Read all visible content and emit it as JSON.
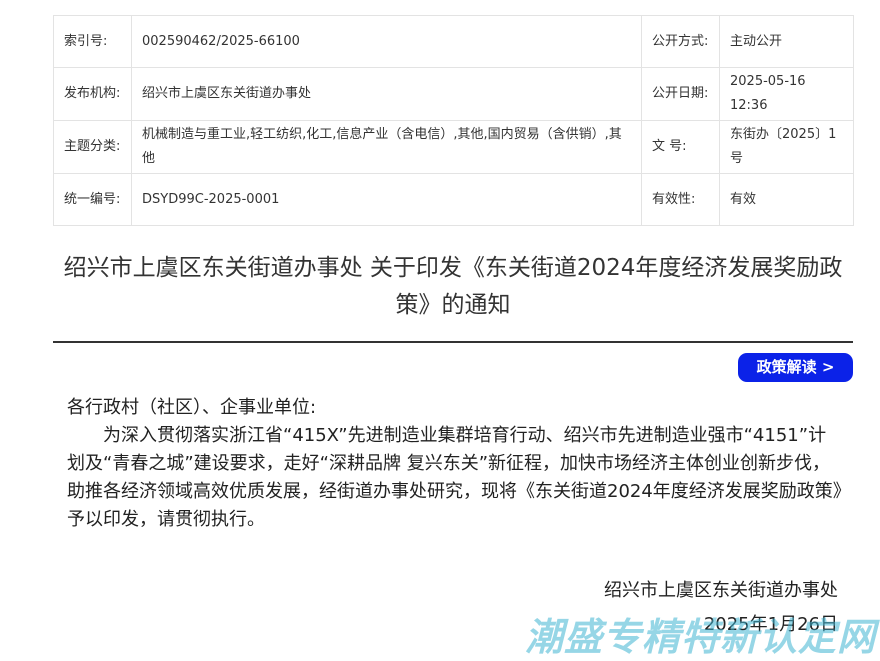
{
  "meta": {
    "rows": [
      [
        {
          "label": "索引号:",
          "value": "002590462/2025-66100"
        },
        {
          "label": "公开方式:",
          "value": "主动公开"
        }
      ],
      [
        {
          "label": "发布机构:",
          "value": "绍兴市上虞区东关街道办事处"
        },
        {
          "label": "公开日期:",
          "value": "2025-05-16 12:36"
        }
      ],
      [
        {
          "label": "主题分类:",
          "value": "机械制造与重工业,轻工纺织,化工,信息产业（含电信）,其他,国内贸易（含供销）,其他"
        },
        {
          "label": "文  号:",
          "value": "东街办〔2025〕1号"
        }
      ],
      [
        {
          "label": "统一编号:",
          "value": "DSYD99C-2025-0001"
        },
        {
          "label": "有效性:",
          "value": "有效"
        }
      ]
    ]
  },
  "title": "绍兴市上虞区东关街道办事处 关于印发《东关街道2024年度经济发展奖励政策》的通知",
  "interpret_button": "政策解读 >",
  "body": {
    "salutation": "各行政村（社区）、企事业单位:",
    "paragraph": "为深入贯彻落实浙江省“415X”先进制造业集群培育行动、绍兴市先进制造业强市“4151”计划及“青春之城”建设要求，走好“深耕品牌 复兴东关”新征程，加快市场经济主体创业创新步伐，助推各经济领域高效优质发展，经街道办事处研究，现将《东关街道2024年度经济发展奖励政策》予以印发，请贯彻执行。"
  },
  "signature": {
    "org": "绍兴市上虞区东关街道办事处",
    "date": "2025年1月26日"
  },
  "watermark": "潮盛专精特新认定网"
}
